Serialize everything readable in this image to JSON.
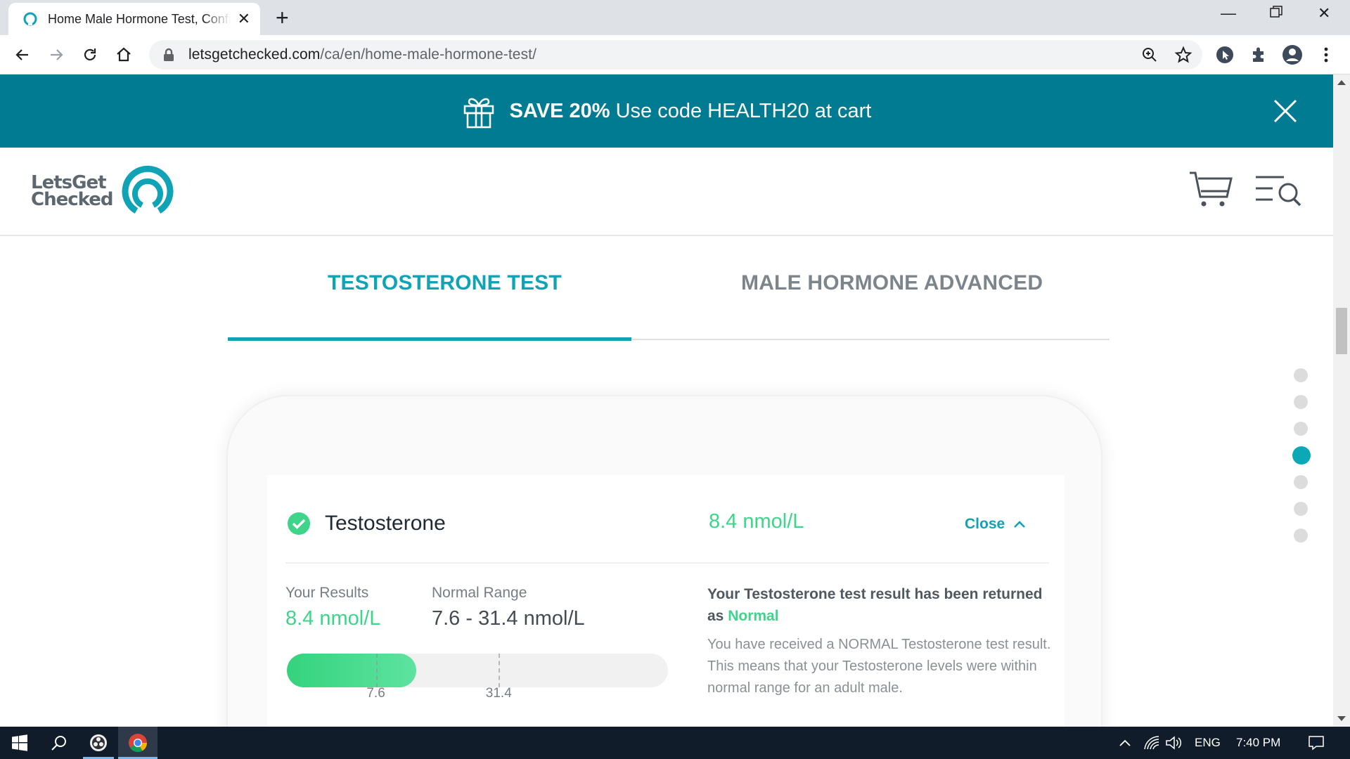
{
  "browser": {
    "tab_title": "Home Male Hormone Test, Confidential",
    "url_domain": "letsgetchecked.com",
    "url_path": "/ca/en/home-male-hormone-test/"
  },
  "promo": {
    "strong": "SAVE 20%",
    "text": "Use code HEALTH20 at cart"
  },
  "header": {
    "logo_line1": "LetsGet",
    "logo_line2": "Checked"
  },
  "tabs": [
    {
      "label": "TESTOSTERONE TEST",
      "active": true
    },
    {
      "label": "MALE HORMONE ADVANCED",
      "active": false
    }
  ],
  "pager": {
    "count": 7,
    "active_index": 3
  },
  "result_card": {
    "test_name": "Testosterone",
    "header_value": "8.4 nmol/L",
    "close_label": "Close",
    "your_results_label": "Your Results",
    "your_results_value": "8.4 nmol/L",
    "normal_range_label": "Normal Range",
    "normal_range_value": "7.6 - 31.4 nmol/L",
    "range_bar": {
      "min_label": "7.6",
      "max_label": "31.4",
      "fill_fraction": 0.34,
      "min_marker_fraction": 0.235,
      "max_marker_fraction": 0.555
    },
    "message_heading": "Your Testosterone test result has been returned as",
    "message_status": "Normal",
    "message_body": "You have received a NORMAL Testosterone test result. This means that your Testosterone levels were within normal range for an adult male."
  },
  "taskbar": {
    "language": "ENG",
    "time": "7:40 PM"
  },
  "colors": {
    "brand_teal": "#10a3b6",
    "promo_bg": "#007b92",
    "result_green": "#3ed58a"
  }
}
